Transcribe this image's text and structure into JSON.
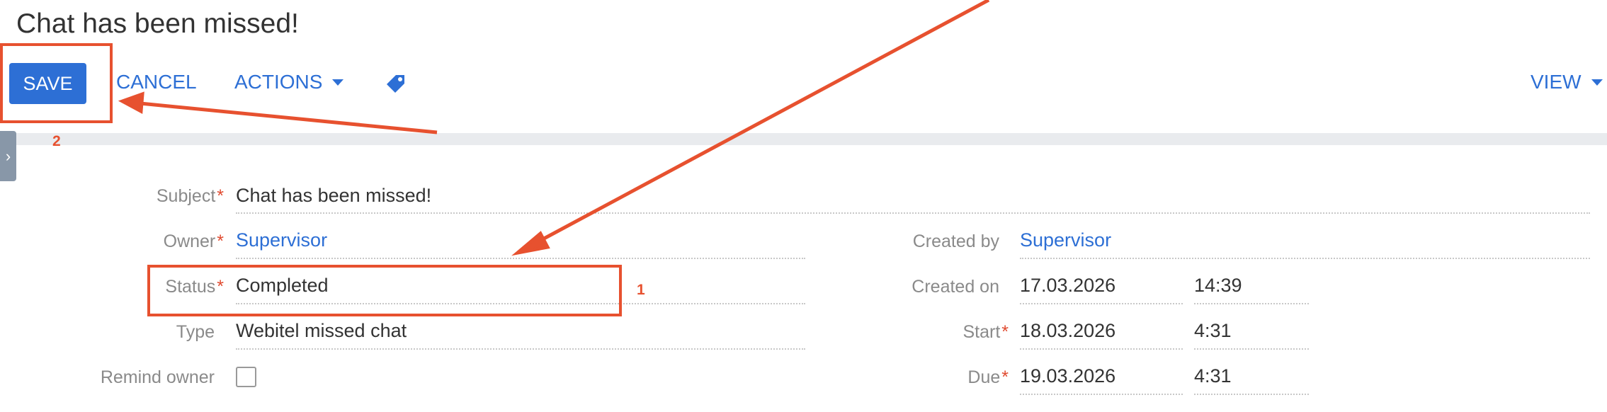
{
  "page": {
    "title": "Chat has been missed!"
  },
  "toolbar": {
    "save_label": "SAVE",
    "cancel_label": "CANCEL",
    "actions_label": "ACTIONS",
    "view_label": "VIEW"
  },
  "form": {
    "subject": {
      "label": "Subject",
      "value": "Chat has been missed!",
      "required": "*"
    },
    "owner": {
      "label": "Owner",
      "value": "Supervisor",
      "required": "*"
    },
    "status": {
      "label": "Status",
      "value": "Completed",
      "required": "*"
    },
    "type": {
      "label": "Type",
      "value": "Webitel missed chat"
    },
    "remind_owner": {
      "label": "Remind owner",
      "checked": false
    },
    "created_by": {
      "label": "Created by",
      "value": "Supervisor"
    },
    "created_on": {
      "label": "Created on",
      "date": "17.03.2026",
      "time": "14:39"
    },
    "start": {
      "label": "Start",
      "date": "18.03.2026",
      "time": "4:31",
      "required": "*"
    },
    "due": {
      "label": "Due",
      "date": "19.03.2026",
      "time": "4:31",
      "required": "*"
    }
  },
  "annotations": {
    "one": "1",
    "two": "2"
  },
  "colors": {
    "accent": "#2d6fd5",
    "annotation": "#e7512f",
    "required": "#e04a2f"
  },
  "icons": {
    "tag": "tag-icon",
    "caret": "caret-down-icon",
    "side_tab": "chevron-right-icon"
  }
}
